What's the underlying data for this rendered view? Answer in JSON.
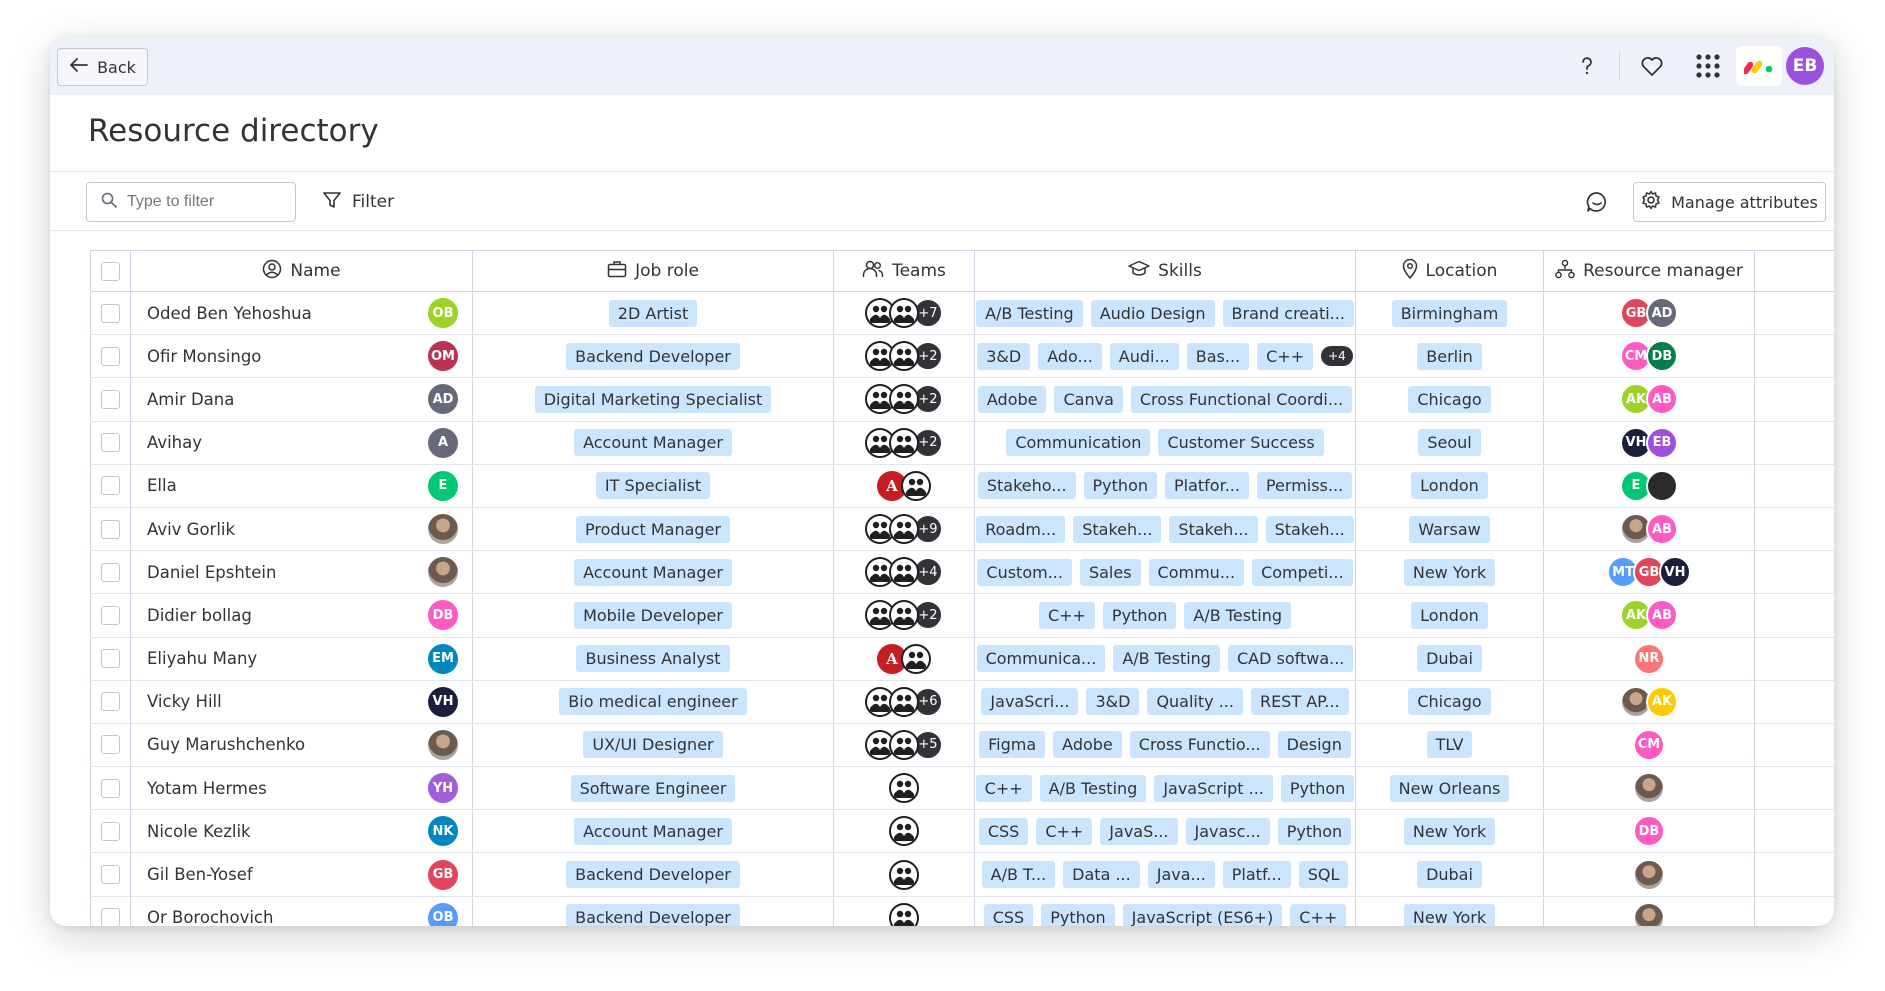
{
  "topbar": {
    "back_label": "Back",
    "icons": [
      "help-icon",
      "heart-icon",
      "apps-grid-icon",
      "monday-logo-icon"
    ],
    "user_initials": "EB",
    "user_color": "#9d50dd"
  },
  "page_title": "Resource directory",
  "toolbar": {
    "filter_placeholder": "Type to filter",
    "filter_label": "Filter",
    "manage_label": "Manage attributes"
  },
  "columns": {
    "name": "Name",
    "job_role": "Job role",
    "teams": "Teams",
    "skills": "Skills",
    "location": "Location",
    "resource_manager": "Resource manager"
  },
  "rows": [
    {
      "name": "Oded Ben Yehoshua",
      "initials": "OB",
      "color": "#9cd326",
      "role": "2D Artist",
      "teams": [
        "bw",
        "bw"
      ],
      "teams_more": "+7",
      "skills": [
        "A/B Testing",
        "Audio Design",
        "Brand creati..."
      ],
      "skills_more": "",
      "location": "Birmingham",
      "managers": [
        {
          "i": "GB",
          "c": "#e2445c"
        },
        {
          "i": "AD",
          "c": "#676879"
        }
      ]
    },
    {
      "name": "Ofir Monsingo",
      "initials": "OM",
      "color": "#bb3354",
      "role": "Backend Developer",
      "teams": [
        "bw",
        "bw"
      ],
      "teams_more": "+2",
      "skills": [
        "3&D",
        "Ado...",
        "Audi...",
        "Bas...",
        "C++"
      ],
      "skills_more": "+4",
      "location": "Berlin",
      "managers": [
        {
          "i": "CM",
          "c": "#ff5ac4"
        },
        {
          "i": "DB",
          "c": "#037f4c"
        }
      ]
    },
    {
      "name": "Amir Dana",
      "initials": "AD",
      "color": "#676879",
      "role": "Digital Marketing Specialist",
      "teams": [
        "bw",
        "bw"
      ],
      "teams_more": "+2",
      "skills": [
        "Adobe",
        "Canva",
        "Cross Functional Coordi..."
      ],
      "skills_more": "",
      "location": "Chicago",
      "managers": [
        {
          "i": "AK",
          "c": "#9cd326"
        },
        {
          "i": "AB",
          "c": "#ff5ac4"
        }
      ]
    },
    {
      "name": "Avihay",
      "initials": "A",
      "color": "#676879",
      "role": "Account Manager",
      "teams": [
        "bw",
        "bw"
      ],
      "teams_more": "+2",
      "skills": [
        "Communication",
        "Customer Success"
      ],
      "skills_more": "",
      "location": "Seoul",
      "managers": [
        {
          "i": "VH",
          "c": "#1c1f3b"
        },
        {
          "i": "EB",
          "c": "#9d50dd"
        }
      ]
    },
    {
      "name": "Ella",
      "initials": "E",
      "color": "#00c875",
      "role": "IT Specialist",
      "teams": [
        "red",
        "bw"
      ],
      "teams_more": "",
      "skills": [
        "Stakeho...",
        "Python",
        "Platfor...",
        "Permiss..."
      ],
      "skills_more": "",
      "location": "London",
      "managers": [
        {
          "i": "E",
          "c": "#00c875"
        },
        {
          "i": "",
          "c": "#2b2b2b"
        }
      ]
    },
    {
      "name": "Aviv Gorlik",
      "initials": "",
      "color": "photo",
      "role": "Product Manager",
      "teams": [
        "bw",
        "bw"
      ],
      "teams_more": "+9",
      "skills": [
        "Roadm...",
        "Stakeh...",
        "Stakeh...",
        "Stakeh..."
      ],
      "skills_more": "",
      "location": "Warsaw",
      "managers": [
        {
          "i": "",
          "c": "photo"
        },
        {
          "i": "AB",
          "c": "#ff5ac4"
        }
      ]
    },
    {
      "name": "Daniel Epshtein",
      "initials": "",
      "color": "photo",
      "role": "Account Manager",
      "teams": [
        "bw",
        "bw"
      ],
      "teams_more": "+4",
      "skills": [
        "Custom...",
        "Sales",
        "Commu...",
        "Competi..."
      ],
      "skills_more": "",
      "location": "New York",
      "managers": [
        {
          "i": "MT",
          "c": "#579bfc"
        },
        {
          "i": "GB",
          "c": "#e2445c"
        },
        {
          "i": "VH",
          "c": "#1c1f3b"
        }
      ]
    },
    {
      "name": "Didier bollag",
      "initials": "DB",
      "color": "#ff5ac4",
      "role": "Mobile Developer",
      "teams": [
        "bw",
        "bw"
      ],
      "teams_more": "+2",
      "skills": [
        "C++",
        "Python",
        "A/B Testing"
      ],
      "skills_more": "",
      "location": "London",
      "managers": [
        {
          "i": "AK",
          "c": "#9cd326"
        },
        {
          "i": "AB",
          "c": "#ff5ac4"
        }
      ]
    },
    {
      "name": "Eliyahu Many",
      "initials": "EM",
      "color": "#0086c0",
      "role": "Business Analyst",
      "teams": [
        "red",
        "bw"
      ],
      "teams_more": "",
      "skills": [
        "Communica...",
        "A/B Testing",
        "CAD softwa..."
      ],
      "skills_more": "",
      "location": "Dubai",
      "managers": [
        {
          "i": "NR",
          "c": "#ff7575"
        }
      ]
    },
    {
      "name": "Vicky Hill",
      "initials": "VH",
      "color": "#1c1f3b",
      "role": "Bio medical engineer",
      "teams": [
        "bw",
        "bw"
      ],
      "teams_more": "+6",
      "skills": [
        "JavaScri...",
        "3&D",
        "Quality ...",
        "REST AP..."
      ],
      "skills_more": "",
      "location": "Chicago",
      "managers": [
        {
          "i": "",
          "c": "photo"
        },
        {
          "i": "AK",
          "c": "#ffcb00"
        }
      ]
    },
    {
      "name": "Guy Marushchenko",
      "initials": "",
      "color": "photo",
      "role": "UX/UI Designer",
      "teams": [
        "bw",
        "bw"
      ],
      "teams_more": "+5",
      "skills": [
        "Figma",
        "Adobe",
        "Cross Functio...",
        "Design"
      ],
      "skills_more": "",
      "location": "TLV",
      "managers": [
        {
          "i": "CM",
          "c": "#ff5ac4"
        }
      ]
    },
    {
      "name": "Yotam Hermes",
      "initials": "YH",
      "color": "#a25ddc",
      "role": "Software Engineer",
      "teams": [
        "bw"
      ],
      "teams_more": "",
      "skills": [
        "C++",
        "A/B Testing",
        "JavaScript ...",
        "Python"
      ],
      "skills_more": "",
      "location": "New Orleans",
      "managers": [
        {
          "i": "",
          "c": "photo"
        }
      ]
    },
    {
      "name": "Nicole Kezlik",
      "initials": "NK",
      "color": "#0086c0",
      "role": "Account Manager",
      "teams": [
        "bw"
      ],
      "teams_more": "",
      "skills": [
        "CSS",
        "C++",
        "JavaS...",
        "Javasc...",
        "Python"
      ],
      "skills_more": "",
      "location": "New York",
      "managers": [
        {
          "i": "DB",
          "c": "#ff5ac4"
        }
      ]
    },
    {
      "name": "Gil Ben-Yosef",
      "initials": "GB",
      "color": "#e2445c",
      "role": "Backend Developer",
      "teams": [
        "bw"
      ],
      "teams_more": "",
      "skills": [
        "A/B T...",
        "Data ...",
        "Java...",
        "Platf...",
        "SQL"
      ],
      "skills_more": "",
      "location": "Dubai",
      "managers": [
        {
          "i": "",
          "c": "photo"
        }
      ]
    },
    {
      "name": "Or Borochovich",
      "initials": "OB",
      "color": "#579bfc",
      "role": "Backend Developer",
      "teams": [
        "bw"
      ],
      "teams_more": "",
      "skills": [
        "CSS",
        "Python",
        "JavaScript (ES6+)",
        "C++"
      ],
      "skills_more": "",
      "location": "New York",
      "managers": [
        {
          "i": "",
          "c": "photo"
        }
      ]
    }
  ]
}
